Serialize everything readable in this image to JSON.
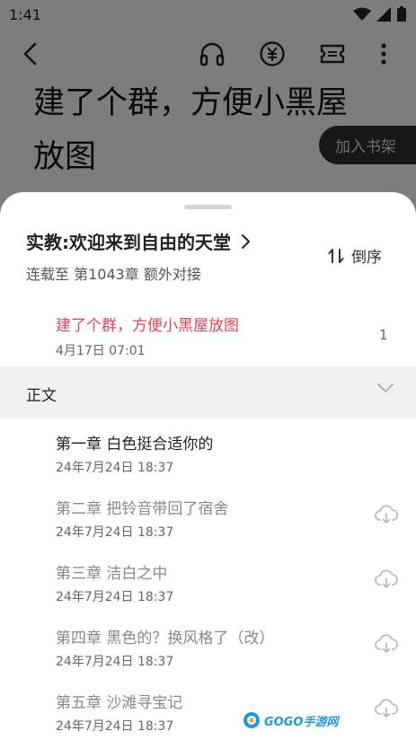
{
  "status_bar": {
    "time": "1:41"
  },
  "background": {
    "title": "建了个群，方便小黑屋放图",
    "add_to_shelf": "加入书架"
  },
  "sheet": {
    "book_title": "实教:欢迎来到自由的天堂",
    "serial_status": "连载至 第1043章 额外对接",
    "sort_label": "倒序",
    "pinned": {
      "title": "建了个群，方便小黑屋放图",
      "date": "4月17日 07:01",
      "count": "1"
    },
    "section_label": "正文",
    "chapters": [
      {
        "title": "第一章 白色挺合适你的",
        "date": "24年7月24日 18:37",
        "color": "#222222",
        "downloadable": false
      },
      {
        "title": "第二章 把铃音带回了宿舍",
        "date": "24年7月24日 18:37",
        "color": "#888888",
        "downloadable": true
      },
      {
        "title": "第三章 洁白之中",
        "date": "24年7月24日 18:37",
        "color": "#888888",
        "downloadable": true
      },
      {
        "title": "第四章 黑色的？换风格了（改）",
        "date": "24年7月24日 18:37",
        "color": "#888888",
        "downloadable": true
      },
      {
        "title": "第五章 沙滩寻宝记",
        "date": "24年7月24日 18:37",
        "color": "#888888",
        "downloadable": true
      }
    ]
  },
  "watermark": {
    "text": "GOGO手游网"
  },
  "colors": {
    "accent_red": "#e0465b",
    "overlay": "rgba(0,0,0,0.5)",
    "section_bg": "#f1f1f1"
  }
}
